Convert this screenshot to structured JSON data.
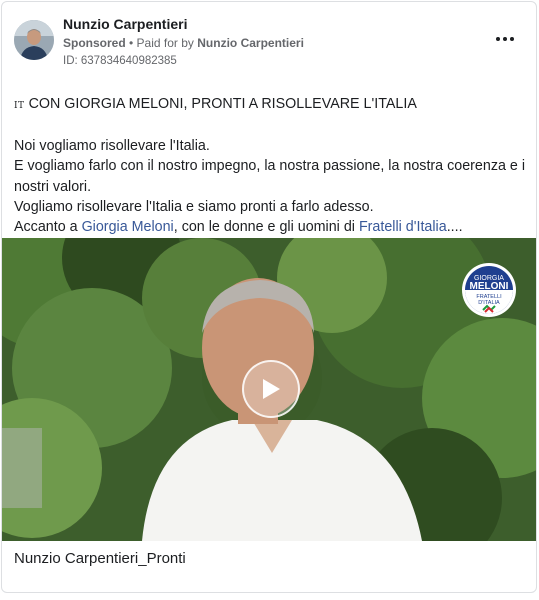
{
  "post": {
    "author": "Nunzio Carpentieri",
    "sponsored_label": "Sponsored",
    "separator": " • ",
    "paid_for_prefix": "Paid for by ",
    "payer": "Nunzio Carpentieri",
    "ad_id": "ID: 637834640982385",
    "flag_code": "IT",
    "headline": "CON GIORGIA MELONI, PRONTI A RISOLLEVARE L'ITALIA",
    "line1": "Noi vogliamo risollevare l'Italia.",
    "line2": "E vogliamo farlo con il nostro impegno, la nostra passione, la nostra coerenza e i nostri valori.",
    "line3": "Vogliamo risollevare l'Italia e siamo pronti a farlo adesso.",
    "line4_prefix": "Accanto a ",
    "line4_link1": "Giorgia Meloni",
    "line4_middle": ", con le donne e gli uomini di ",
    "line4_link2": "Fratelli d'Italia",
    "line4_suffix": "....",
    "video_caption": "Nunzio Carpentieri_Pronti"
  },
  "logo": {
    "line1": "GIORGIA",
    "line2": "MELONI",
    "line3": "FRATELLI",
    "line4": "D'ITALIA"
  },
  "colors": {
    "link": "#385898",
    "secondary_text": "#65676b",
    "border": "#dddfe2"
  },
  "icons": [
    "more-options-icon",
    "play-icon",
    "avatar"
  ]
}
